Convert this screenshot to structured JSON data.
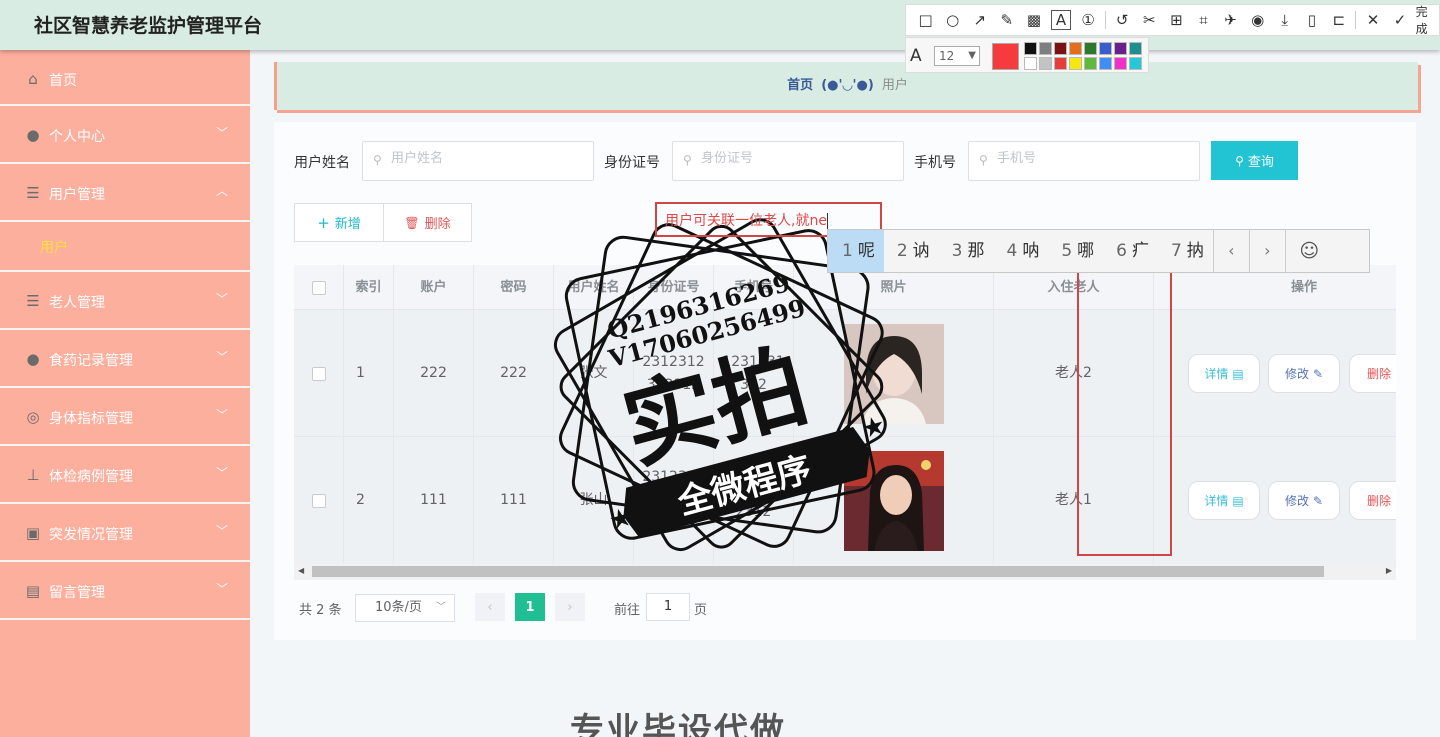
{
  "header": {
    "title": "社区智慧养老监护管理平台"
  },
  "snap_toolbar": {
    "icons": [
      "rect-icon",
      "ellipse-icon",
      "arrow-icon",
      "pen-icon",
      "mosaic-icon",
      "text-icon",
      "number-icon",
      "undo-icon",
      "pin-icon",
      "ocr-icon",
      "crop-icon",
      "translate-icon",
      "record-icon",
      "download-icon",
      "phone-icon",
      "bookmark-icon",
      "close-icon"
    ],
    "done_label": "完成",
    "font_size": "12",
    "current_color": "#f53b3b",
    "palette": [
      "#111111",
      "#7f7f7f",
      "#7b1111",
      "#e46e1e",
      "#2d7a2d",
      "#3b5ccf",
      "#6b1f8f",
      "#1e8f8f",
      "#ffffff",
      "#c3c3c3",
      "#e83d3d",
      "#f5e80f",
      "#5fb93b",
      "#3f8df5",
      "#f030c8",
      "#25c8d6"
    ]
  },
  "sidebar": {
    "items": [
      {
        "label": "首页",
        "icon": "home-icon",
        "glyph": "⌂"
      },
      {
        "label": "个人中心",
        "icon": "person-icon",
        "glyph": "●"
      },
      {
        "label": "用户管理",
        "icon": "sliders-icon",
        "glyph": "☰"
      },
      {
        "label": "老人管理",
        "icon": "list-icon",
        "glyph": "☰"
      },
      {
        "label": "食药记录管理",
        "icon": "person-icon",
        "glyph": "●"
      },
      {
        "label": "身体指标管理",
        "icon": "lifebuoy-icon",
        "glyph": "◎"
      },
      {
        "label": "体检病例管理",
        "icon": "pin-icon",
        "glyph": "⊥"
      },
      {
        "label": "突发情况管理",
        "icon": "briefcase-icon",
        "glyph": "▣"
      },
      {
        "label": "留言管理",
        "icon": "clipboard-icon",
        "glyph": "▤"
      }
    ],
    "sub_active": "用户"
  },
  "breadcrumb": {
    "home": "首页",
    "face": "(●'◡'●)",
    "current": "用户"
  },
  "search": {
    "name_label": "用户姓名",
    "name_placeholder": "用户姓名",
    "id_label": "身份证号",
    "id_placeholder": "身份证号",
    "phone_label": "手机号",
    "phone_placeholder": "手机号",
    "query_label": "查询"
  },
  "actions": {
    "add_label": "新增",
    "delete_label": "删除"
  },
  "table": {
    "columns": [
      "索引",
      "账户",
      "密码",
      "用户姓名",
      "身份证号",
      "手机号",
      "照片",
      "入住老人",
      "操作"
    ],
    "rows": [
      {
        "index": "1",
        "account": "222",
        "password": "222",
        "name": "张文",
        "id_no": "2312312312312",
        "phone": "1231231312",
        "elder": "老人2",
        "photo_bg": "#d8c6c0"
      },
      {
        "index": "2",
        "account": "111",
        "password": "111",
        "name": "张山",
        "id_no": "23123122312312 3",
        "phone": "12312312312",
        "elder": "老人1",
        "photo_bg": "#6a2a2f"
      }
    ],
    "op_detail": "详情",
    "op_edit": "修改",
    "op_delete": "删除"
  },
  "pagination": {
    "total": "共 2 条",
    "page_size": "10条/页",
    "current_page": "1",
    "goto_label": "前往",
    "goto_value": "1",
    "page_suffix": "页"
  },
  "annotation": {
    "text": "用户可关联一位老人,就ne"
  },
  "ime": {
    "candidates": [
      {
        "n": "1",
        "c": "呢"
      },
      {
        "n": "2",
        "c": "讷"
      },
      {
        "n": "3",
        "c": "那"
      },
      {
        "n": "4",
        "c": "呐"
      },
      {
        "n": "5",
        "c": "哪"
      },
      {
        "n": "6",
        "c": "疒"
      },
      {
        "n": "7",
        "c": "抐"
      }
    ]
  },
  "watermark": {
    "line1": "Q2196316269",
    "line2": "V17060256499",
    "main": "实拍",
    "ribbon": "全微程序",
    "bottom_text": "专业毕设代做"
  }
}
